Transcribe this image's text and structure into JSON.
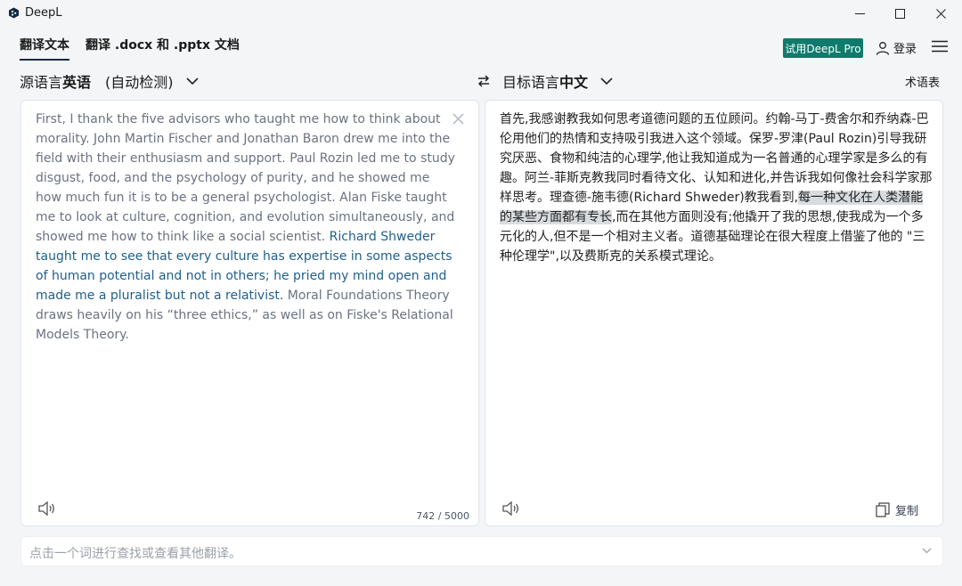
{
  "window": {
    "title": "DeepL"
  },
  "tabs": [
    {
      "label": "翻译文本"
    },
    {
      "label": "翻译 .docx 和 .pptx 文档"
    }
  ],
  "header": {
    "pro_button": "试用DeepL Pro",
    "login": "登录"
  },
  "source": {
    "prefix": "源语言",
    "language": "英语",
    "auto_detect": "(自动检测)",
    "text_before": "First, I thank the five advisors who taught me how to think about morality. John Martin Fischer and Jonathan Baron drew me into the field with their enthusiasm and support. Paul Rozin led me to study disgust, food, and the psychology of purity, and he showed me how much fun it is to be a general psychologist. Alan Fiske taught me to look at culture, cognition, and evolution simultaneously, and showed me how to think like a social scientist. ",
    "text_highlight": "Richard Shweder taught me to see that every culture has expertise in some aspects of human potential and not in others; he pried my mind open and made me a pluralist but not a relativist.",
    "text_after": " Moral Foundations Theory draws heavily on his “three ethics,” as well as on Fiske's Relational Models Theory.",
    "char_count": "742 / 5000"
  },
  "target": {
    "prefix": "目标语言",
    "language": "中文",
    "glossary": "术语表",
    "text_before": "首先,我感谢教我如何思考道德问题的五位顾问。约翰-马丁-费舍尔和乔纳森-巴伦用他们的热情和支持吸引我进入这个领域。保罗-罗津(Paul Rozin)引导我研究厌恶、食物和纯洁的心理学,他让我知道成为一名普通的心理学家是多么的有趣。阿兰-菲斯克教我同时看待文化、认知和进化,并告诉我如何像社会科学家那样思考。理查德-施韦德(Richard Shweder)教我看到,",
    "text_selected": "每一种文化在人类潜能的某些方面都有专长",
    "text_after": ",而在其他方面则没有;他撬开了我的思想,使我成为一个多元化的人,但不是一个相对主义者。道德基础理论在很大程度上借鉴了他的 \"三种伦理学\",以及费斯克的关系模式理论。",
    "copy_label": "复制"
  },
  "dictionary": {
    "placeholder": "点击一个词进行查找或查看其他翻译。"
  },
  "colors": {
    "accent": "#0f7b6c",
    "link_text": "#1f5f8b",
    "selection": "#d9dcdf"
  }
}
